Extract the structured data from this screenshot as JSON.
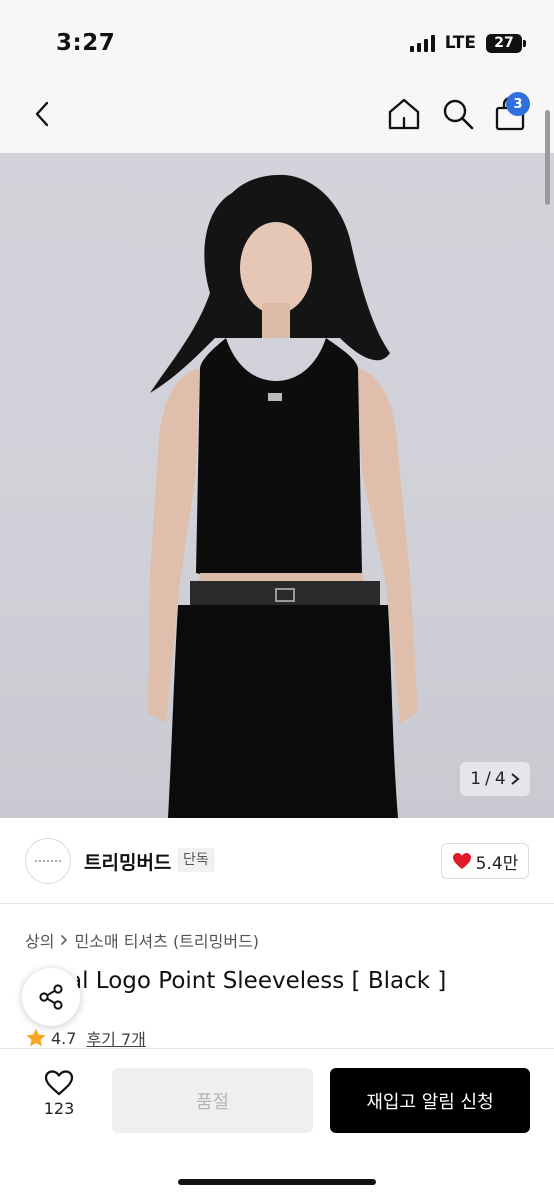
{
  "status_bar": {
    "time": "3:27",
    "network": "LTE",
    "battery": "27"
  },
  "header": {
    "cart_count": "3"
  },
  "icons": {
    "back": "chevron-left-icon",
    "home": "home-icon",
    "search": "search-icon",
    "cart": "shopping-bag-icon",
    "share": "share-icon",
    "heart": "heart-icon",
    "star": "star-icon"
  },
  "image_pager": {
    "current": "1",
    "separator": "/",
    "total": "4"
  },
  "brand": {
    "name": "트리밍버드",
    "tag": "단독",
    "likes": "5.4만"
  },
  "breadcrumb": {
    "category": "상의",
    "subcategory": "민소매 티셔츠 (트리밍버드)"
  },
  "product": {
    "title": "Metal Logo Point Sleeveless [ Black ]",
    "rating": "4.7",
    "reviews": "후기 7개"
  },
  "bottom_bar": {
    "wish_count": "123",
    "soldout_label": "품절",
    "restock_label": "재입고 알림 신청"
  },
  "colors": {
    "badge": "#2f6fe0",
    "heart": "#e0192b",
    "star": "#f5a623",
    "primary_button": "#000000"
  }
}
